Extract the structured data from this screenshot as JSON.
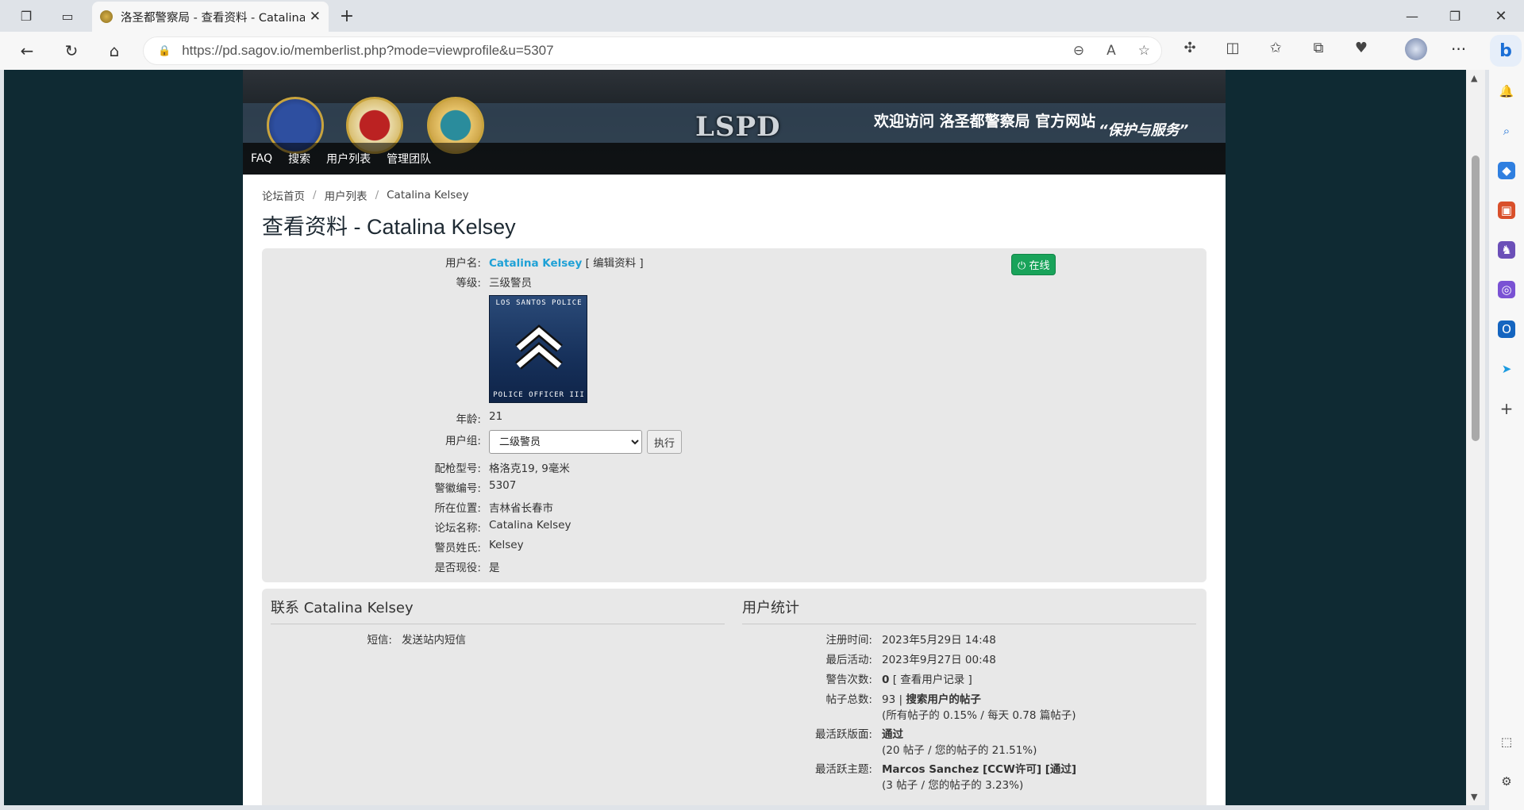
{
  "browser": {
    "tab_title": "洛圣都警察局 - 查看资料 - Catalina Kelsey",
    "url": "https://pd.sagov.io/memberlist.php?mode=viewprofile&u=5307"
  },
  "banner": {
    "logo_text": "LSPD",
    "welcome": "欢迎访问 洛圣都警察局 官方网站",
    "motto": "“保护与服务”"
  },
  "nav": {
    "items": [
      "FAQ",
      "搜索",
      "用户列表",
      "管理团队"
    ]
  },
  "breadcrumb": [
    "论坛首页",
    "用户列表",
    "Catalina Kelsey"
  ],
  "page_title": "查看资料 - Catalina Kelsey",
  "profile": {
    "username_label": "用户名:",
    "username": "Catalina Kelsey",
    "edit_link": "[ 编辑资料 ]",
    "online_badge": "在线",
    "rank_label": "等级:",
    "rank": "三级警员",
    "rank_image_top": "LOS SANTOS POLICE",
    "rank_image_bottom": "POLICE OFFICER III",
    "age_label": "年龄:",
    "age": "21",
    "group_label": "用户组:",
    "group_selected": "二级警员",
    "group_button": "执行",
    "fields": [
      {
        "label": "配枪型号:",
        "value": "格洛克19, 9毫米"
      },
      {
        "label": "警徽编号:",
        "value": "5307"
      },
      {
        "label": "所在位置:",
        "value": "吉林省长春市"
      },
      {
        "label": "论坛名称:",
        "value": "Catalina Kelsey"
      },
      {
        "label": "警员姓氏:",
        "value": "Kelsey"
      },
      {
        "label": "是否现役:",
        "value": "是"
      }
    ]
  },
  "contact": {
    "heading": "联系 Catalina Kelsey",
    "pm_label": "短信:",
    "pm_link": "发送站内短信"
  },
  "stats": {
    "heading": "用户统计",
    "joined_label": "注册时间:",
    "joined": "2023年5月29日 14:48",
    "last_active_label": "最后活动:",
    "last_active": "2023年9月27日 00:48",
    "warnings_label": "警告次数:",
    "warnings_count": "0",
    "warnings_link": "[ 查看用户记录 ]",
    "posts_label": "帖子总数:",
    "posts_count": "93 |",
    "posts_search": "搜索用户的帖子",
    "posts_sub": "(所有帖子的 0.15% / 每天 0.78 篇帖子)",
    "active_forum_label": "最活跃版面:",
    "active_forum": "通过",
    "active_forum_sub": "(20 帖子 / 您的帖子的 21.51%)",
    "active_topic_label": "最活跃主题:",
    "active_topic": "Marcos Sanchez [CCW许可] [通过]",
    "active_topic_sub": "(3 帖子 / 您的帖子的 3.23%)"
  }
}
